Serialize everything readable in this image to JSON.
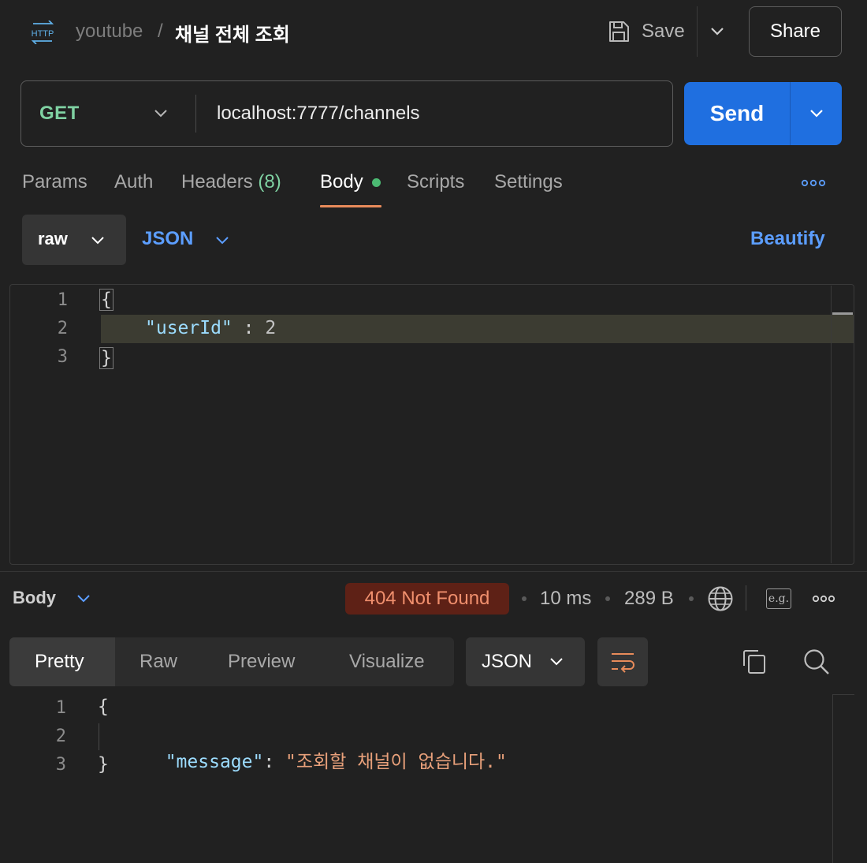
{
  "header": {
    "http_icon_text": "HTTP",
    "collection": "youtube",
    "separator": "/",
    "request_name": "채널 전체 조회",
    "save_label": "Save",
    "share_label": "Share"
  },
  "request": {
    "method": "GET",
    "url": "localhost:7777/channels",
    "send_label": "Send"
  },
  "tabs": {
    "params": "Params",
    "auth": "Auth",
    "headers": "Headers",
    "headers_count": "(8)",
    "body": "Body",
    "scripts": "Scripts",
    "settings": "Settings"
  },
  "body_options": {
    "mode": "raw",
    "language": "JSON",
    "beautify": "Beautify"
  },
  "request_body": {
    "line_numbers": [
      "1",
      "2",
      "3"
    ],
    "open_brace": "{",
    "key": "\"userId\"",
    "colon": " : ",
    "value": "2",
    "close_brace": "}"
  },
  "response": {
    "section_label": "Body",
    "status": "404 Not Found",
    "time": "10 ms",
    "size": "289 B",
    "eg_label": "e.g.",
    "views": [
      "Pretty",
      "Raw",
      "Preview",
      "Visualize"
    ],
    "format": "JSON",
    "line_numbers": [
      "1",
      "2",
      "3"
    ],
    "open_brace": "{",
    "key": "\"message\"",
    "colon": ": ",
    "value": "\"조회할 채널이 없습니다.\"",
    "close_brace": "}"
  },
  "colors": {
    "accent_blue": "#1f6fe0",
    "method_green": "#7fd1a2",
    "status_bg": "#5e2116",
    "status_text": "#f08f6d",
    "tab_underline": "#e88b5a",
    "background": "#212121"
  },
  "icons": {
    "http": "http-icon",
    "save": "floppy-disk-icon",
    "more": "more-horizontal-icon",
    "globe": "globe-icon",
    "wrap": "text-wrap-icon",
    "copy": "copy-icon",
    "search": "search-icon"
  }
}
